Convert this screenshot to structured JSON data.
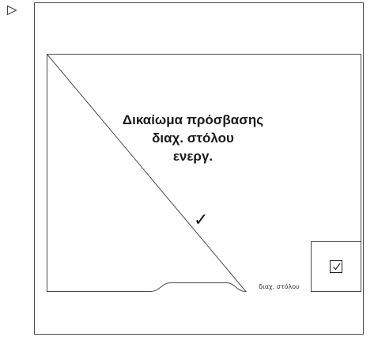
{
  "icons": {
    "play": "play-triangle-icon",
    "check": "check-mark-icon",
    "confirm": "checkbox-checked-icon"
  },
  "message": {
    "line1": "Δικαίωμα πρόσβασης",
    "line2": "διαχ. στόλου",
    "line3": "ενεργ.",
    "check": "✓"
  },
  "tab": {
    "label": "διαχ. στόλου"
  }
}
